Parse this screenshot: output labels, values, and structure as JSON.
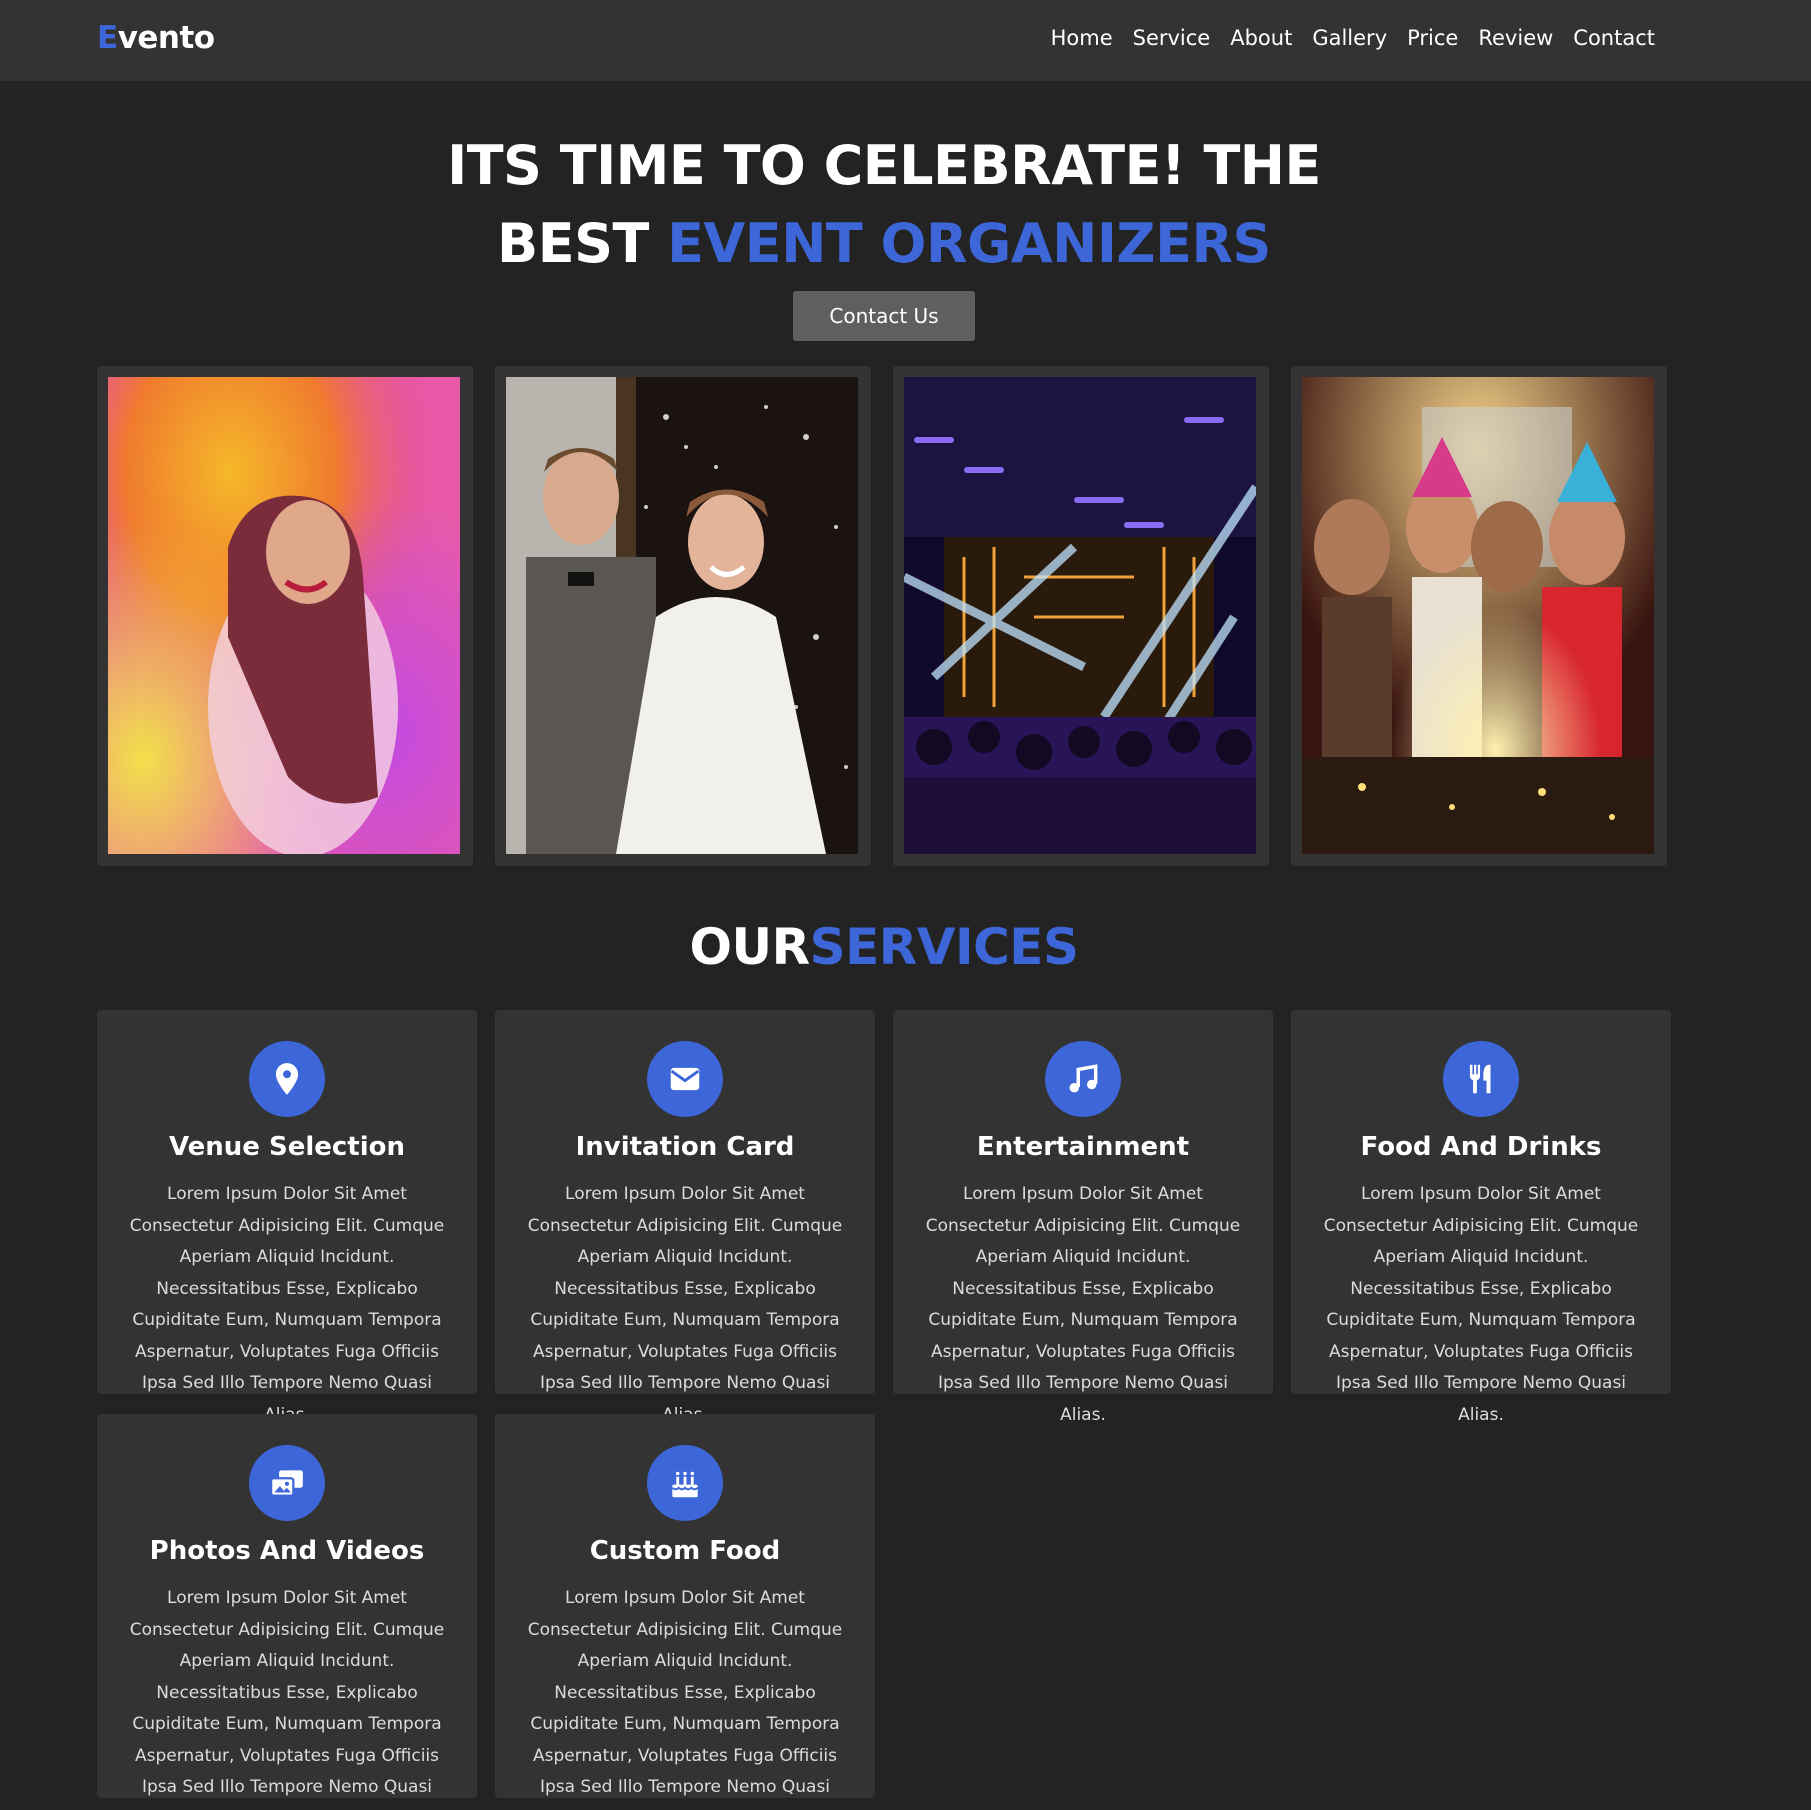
{
  "header": {
    "logo_accent": "E",
    "logo_rest": "vento",
    "nav": [
      "Home",
      "Service",
      "About",
      "Gallery",
      "Price",
      "Review",
      "Contact"
    ]
  },
  "hero": {
    "line1": "ITS TIME TO CELEBRATE! THE",
    "line2_plain": "BEST ",
    "line2_accent": "EVENT ORGANIZERS",
    "cta_label": "Contact Us"
  },
  "gallery": [
    {
      "subject": "woman-holi-colors-photo"
    },
    {
      "subject": "wedding-couple-photo"
    },
    {
      "subject": "concert-stage-lights-photo"
    },
    {
      "subject": "birthday-party-photo"
    }
  ],
  "services": {
    "title_plain": "OUR",
    "title_accent": "SERVICES",
    "items": [
      {
        "icon": "map-pin-icon",
        "title": "Venue Selection",
        "text": "Lorem Ipsum Dolor Sit Amet Consectetur Adipisicing Elit. Cumque Aperiam Aliquid Incidunt. Necessitatibus Esse, Explicabo Cupiditate Eum, Numquam Tempora Aspernatur, Voluptates Fuga Officiis Ipsa Sed Illo Tempore Nemo Quasi Alias."
      },
      {
        "icon": "envelope-icon",
        "title": "Invitation Card",
        "text": "Lorem Ipsum Dolor Sit Amet Consectetur Adipisicing Elit. Cumque Aperiam Aliquid Incidunt. Necessitatibus Esse, Explicabo Cupiditate Eum, Numquam Tempora Aspernatur, Voluptates Fuga Officiis Ipsa Sed Illo Tempore Nemo Quasi Alias."
      },
      {
        "icon": "music-note-icon",
        "title": "Entertainment",
        "text": "Lorem Ipsum Dolor Sit Amet Consectetur Adipisicing Elit. Cumque Aperiam Aliquid Incidunt. Necessitatibus Esse, Explicabo Cupiditate Eum, Numquam Tempora Aspernatur, Voluptates Fuga Officiis Ipsa Sed Illo Tempore Nemo Quasi Alias."
      },
      {
        "icon": "utensils-icon",
        "title": "Food And Drinks",
        "text": "Lorem Ipsum Dolor Sit Amet Consectetur Adipisicing Elit. Cumque Aperiam Aliquid Incidunt. Necessitatibus Esse, Explicabo Cupiditate Eum, Numquam Tempora Aspernatur, Voluptates Fuga Officiis Ipsa Sed Illo Tempore Nemo Quasi Alias."
      },
      {
        "icon": "photo-video-icon",
        "title": "Photos And Videos",
        "text": "Lorem Ipsum Dolor Sit Amet Consectetur Adipisicing Elit. Cumque Aperiam Aliquid Incidunt. Necessitatibus Esse, Explicabo Cupiditate Eum, Numquam Tempora Aspernatur, Voluptates Fuga Officiis Ipsa Sed Illo Tempore Nemo Quasi Alias."
      },
      {
        "icon": "birthday-cake-icon",
        "title": "Custom Food",
        "text": "Lorem Ipsum Dolor Sit Amet Consectetur Adipisicing Elit. Cumque Aperiam Aliquid Incidunt. Necessitatibus Esse, Explicabo Cupiditate Eum, Numquam Tempora Aspernatur, Voluptates Fuga Officiis Ipsa Sed Illo Tempore Nemo Quasi Alias."
      }
    ]
  },
  "colors": {
    "accent": "#3d66d8",
    "background": "#232323",
    "surface": "#333333",
    "button": "#5f5f5f"
  }
}
